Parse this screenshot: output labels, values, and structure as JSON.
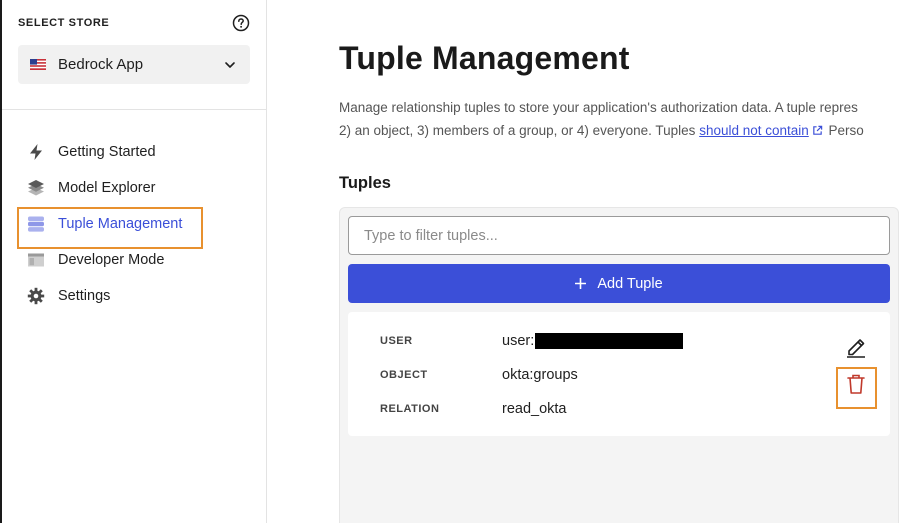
{
  "sidebar": {
    "store_label": "SELECT STORE",
    "store_name": "Bedrock App",
    "nav": [
      {
        "label": "Getting Started",
        "icon": "bolt-icon"
      },
      {
        "label": "Model Explorer",
        "icon": "layers-icon"
      },
      {
        "label": "Tuple Management",
        "icon": "database-icon",
        "active": true
      },
      {
        "label": "Developer Mode",
        "icon": "window-icon"
      },
      {
        "label": "Settings",
        "icon": "gear-icon"
      }
    ]
  },
  "main": {
    "title": "Tuple Management",
    "description_line1": "Manage relationship tuples to store your application's authorization data. A tuple repres",
    "description_line2_pre": "2) an object, 3) members of a group, or 4) everyone. Tuples ",
    "description_link": "should not contain",
    "description_line2_post": " Perso",
    "section_title": "Tuples",
    "filter_placeholder": "Type to filter tuples...",
    "add_tuple_label": "Add Tuple",
    "tuple": {
      "user_key": "USER",
      "user_value": "user:",
      "object_key": "OBJECT",
      "object_value": "okta:groups",
      "relation_key": "RELATION",
      "relation_value": "read_okta"
    }
  },
  "colors": {
    "accent": "#3b4fd8",
    "highlight": "#e8912f",
    "delete": "#c0392b"
  }
}
